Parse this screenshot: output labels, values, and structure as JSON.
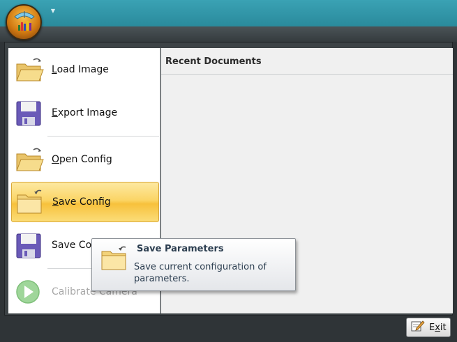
{
  "window": {
    "quick_access_glyph": "▼",
    "app_orb_icon": "bar-chart-orb-icon"
  },
  "menu": {
    "items": [
      {
        "label_accel": "L",
        "label_rest": "oad Image",
        "icon": "folder-open-icon"
      },
      {
        "label_accel": "E",
        "label_rest": "xport Image",
        "icon": "floppy-disk-icon"
      },
      {
        "label_accel": "O",
        "label_rest": "pen Config",
        "icon": "folder-open-icon"
      },
      {
        "label_accel": "S",
        "label_rest": "ave Config",
        "icon": "folder-save-icon",
        "state": "selected"
      },
      {
        "label": "Save Co",
        "icon": "floppy-disk-icon"
      },
      {
        "label": "Calibrate Camera",
        "icon": "play-circle-icon",
        "state": "disabled"
      }
    ],
    "recent_documents_title": "Recent Documents"
  },
  "tooltip": {
    "title": "Save Parameters",
    "description": "Save current configuration of parameters.",
    "icon": "folder-save-icon"
  },
  "footer": {
    "exit_accel": "x",
    "exit_pre": "E",
    "exit_post": "it",
    "exit_icon": "exit-pencil-icon"
  },
  "colors": {
    "title_bar": "#3aa2b4",
    "selected_item": "#fbd566",
    "frame": "#3d4346"
  }
}
